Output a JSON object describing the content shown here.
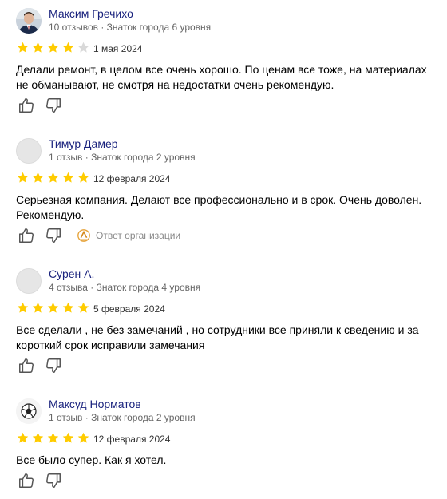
{
  "colors": {
    "star": "#fc0",
    "author": "#1a237e",
    "meta": "#666666"
  },
  "reviews": [
    {
      "author": "Максим Гречихо",
      "meta": "10 отзывов · Знаток города 6 уровня",
      "rating": 4,
      "date": "1 мая 2024",
      "text": "Делали ремонт, в целом все очень хорошо. По ценам все тоже, на материалах не обманывают, не смотря на недостатки очень рекомендую.",
      "avatar": "photo"
    },
    {
      "author": "Тимур Дамер",
      "meta": "1 отзыв · Знаток города 2 уровня",
      "rating": 5,
      "date": "12 февраля 2024",
      "text": "Серьезная компания. Делают все профессионально и в срок. Очень доволен. Рекомендую.",
      "avatar": "blank",
      "org_reply_label": "Ответ организации"
    },
    {
      "author": "Сурен А.",
      "meta": "4 отзыва · Знаток города 4 уровня",
      "rating": 5,
      "date": "5 февраля 2024",
      "text": "Все сделали , не без замечаний , но сотрудники все приняли к сведению и за короткий срок исправили замечания",
      "avatar": "blank"
    },
    {
      "author": "Максуд Норматов",
      "meta": "1 отзыв · Знаток города 2 уровня",
      "rating": 5,
      "date": "12 февраля 2024",
      "text": "Все было супер. Как я хотел.",
      "avatar": "football"
    }
  ]
}
